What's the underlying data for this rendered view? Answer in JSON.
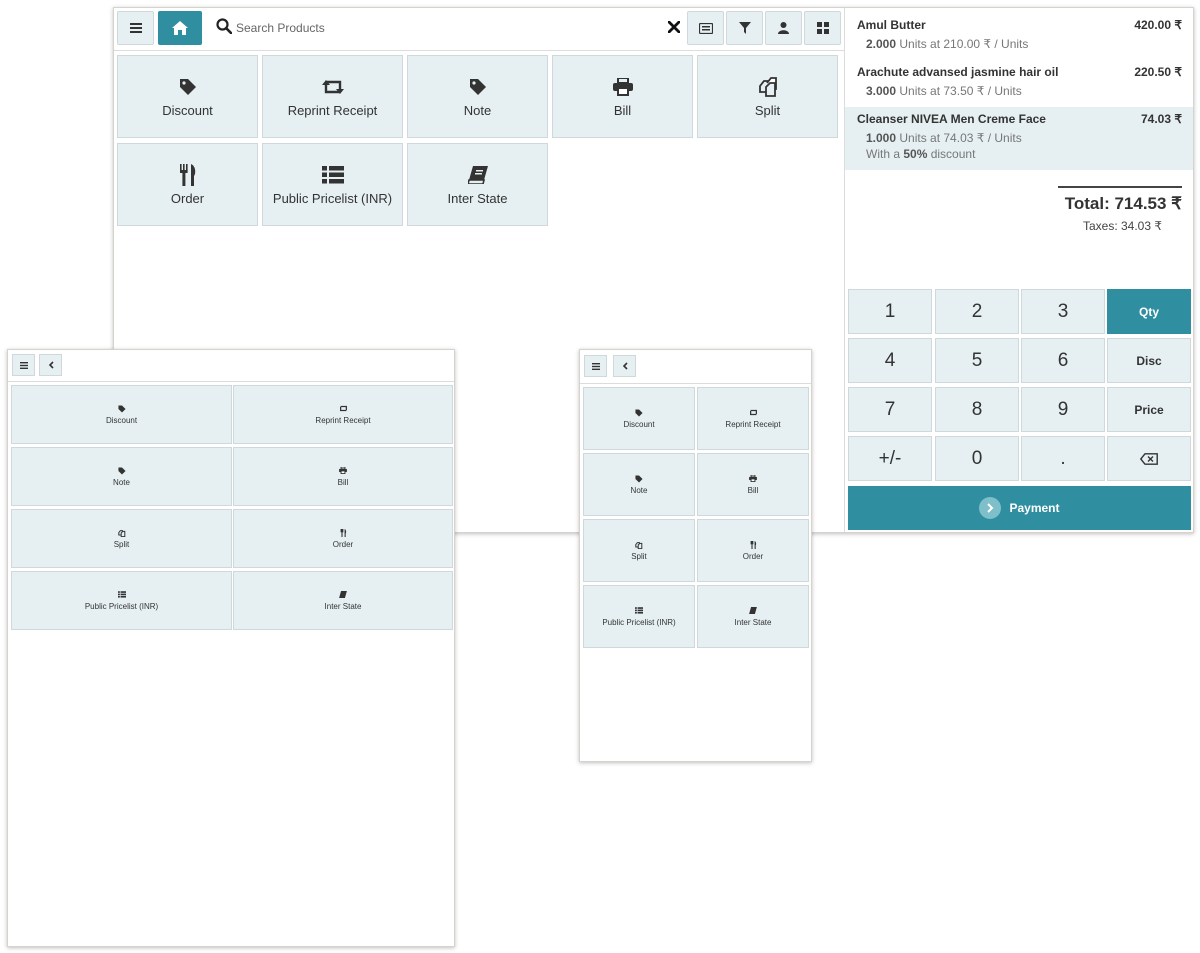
{
  "main_window": {
    "header": {
      "menu_icon": "hamburger-icon",
      "home_icon": "home-icon",
      "search_placeholder": "Search Products",
      "clear_icon": "close-icon",
      "tool_icons": [
        "keyboard-icon",
        "filter-icon",
        "user-icon",
        "grid-icon"
      ]
    },
    "controls": [
      {
        "label": "Discount",
        "icon": "tag-icon"
      },
      {
        "label": "Reprint Receipt",
        "icon": "retweet-icon"
      },
      {
        "label": "Note",
        "icon": "tag-icon"
      },
      {
        "label": "Bill",
        "icon": "printer-icon"
      },
      {
        "label": "Split",
        "icon": "copy-icon"
      },
      {
        "label": "Order",
        "icon": "cutlery-icon"
      },
      {
        "label": "Public Pricelist (INR)",
        "icon": "list-icon"
      },
      {
        "label": "Inter State",
        "icon": "book-icon"
      }
    ],
    "order": {
      "lines": [
        {
          "name": "Amul Butter",
          "price": "420.00 ₹",
          "qty": "2.000",
          "info": " Units at 210.00 ₹ / Units",
          "selected": false
        },
        {
          "name": "Arachute advansed jasmine hair oil",
          "price": "220.50 ₹",
          "qty": "3.000",
          "info": " Units at 73.50 ₹ / Units",
          "selected": false
        },
        {
          "name": "Cleanser NIVEA Men Creme Face",
          "price": "74.03 ₹",
          "qty": "1.000",
          "info": " Units at 74.03 ₹ / Units",
          "selected": true,
          "discount_prefix": "With a ",
          "discount_value": "50%",
          "discount_suffix": " discount"
        }
      ],
      "total": "Total: 714.53 ₹",
      "taxes": "Taxes: 34.03 ₹"
    },
    "numpad": {
      "keys": [
        "1",
        "2",
        "3",
        "Qty",
        "4",
        "5",
        "6",
        "Disc",
        "7",
        "8",
        "9",
        "Price",
        "+/-",
        "0",
        ".",
        "⌫"
      ],
      "active_mode": "Qty"
    },
    "payment_label": "Payment"
  },
  "left_window": {
    "header_icons": [
      "hamburger-icon",
      "chevron-left-icon"
    ],
    "controls": [
      {
        "label": "Discount",
        "icon": "tag-icon"
      },
      {
        "label": "Reprint Receipt",
        "icon": "retweet-icon"
      },
      {
        "label": "Note",
        "icon": "tag-icon"
      },
      {
        "label": "Bill",
        "icon": "printer-icon"
      },
      {
        "label": "Split",
        "icon": "copy-icon"
      },
      {
        "label": "Order",
        "icon": "cutlery-icon"
      },
      {
        "label": "Public Pricelist (INR)",
        "icon": "list-icon"
      },
      {
        "label": "Inter State",
        "icon": "book-icon"
      }
    ]
  },
  "right_window": {
    "header_icons": [
      "hamburger-icon",
      "chevron-left-icon"
    ],
    "controls": [
      {
        "label": "Discount",
        "icon": "tag-icon"
      },
      {
        "label": "Reprint Receipt",
        "icon": "retweet-icon"
      },
      {
        "label": "Note",
        "icon": "tag-icon"
      },
      {
        "label": "Bill",
        "icon": "printer-icon"
      },
      {
        "label": "Split",
        "icon": "copy-icon"
      },
      {
        "label": "Order",
        "icon": "cutlery-icon"
      },
      {
        "label": "Public Pricelist (INR)",
        "icon": "list-icon"
      },
      {
        "label": "Inter State",
        "icon": "book-icon"
      }
    ]
  },
  "colors": {
    "accent": "#2f8fa1",
    "button_bg": "#e6f0f2",
    "selected_line_bg": "#e6f0f2"
  }
}
